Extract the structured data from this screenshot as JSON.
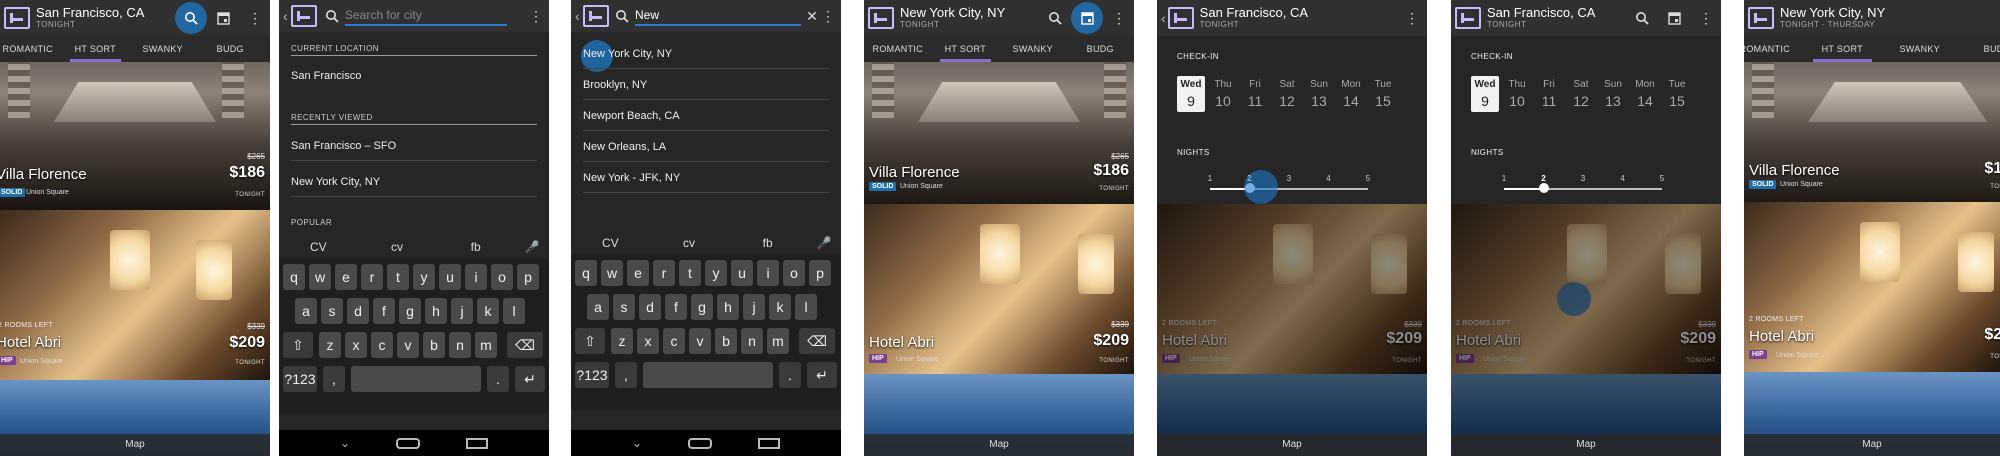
{
  "colors": {
    "accent": "#2a7bd4",
    "brand": "#c9b9ff",
    "tab_indicator": "#8c6fd6",
    "solid_badge": "#1e6fa8",
    "hip_badge": "#7b3f8f"
  },
  "tabs": [
    "ROMANTIC",
    "HT SORT",
    "SWANKY",
    "BUDG"
  ],
  "hotels": [
    {
      "name": "Villa Florence",
      "badge": "SOLID",
      "area": "Union Square",
      "old_price": "$265",
      "price": "$186",
      "per": "TONIGHT"
    },
    {
      "name": "Hotel Abri",
      "badge": "HIP",
      "area": "Union Square",
      "old_price": "$339",
      "price": "$209",
      "per": "TONIGHT",
      "rooms_left": "2 ROOMS LEFT"
    }
  ],
  "map_label": "Map",
  "screen1": {
    "city": "San Francisco, CA",
    "date": "TONIGHT"
  },
  "screen2": {
    "placeholder": "Search for city",
    "current_location_header": "CURRENT LOCATION",
    "current_location": "San Francisco",
    "recently_viewed_header": "RECENTLY VIEWED",
    "recent": [
      "San Francisco – SFO",
      "New York City, NY"
    ],
    "popular_header": "POPULAR"
  },
  "screen3": {
    "query": "New",
    "results": [
      "New York City, NY",
      "Brooklyn, NY",
      "Newport Beach, CA",
      "New Orleans, LA",
      "New York - JFK, NY"
    ]
  },
  "keyboard": {
    "suggestions": [
      "CV",
      "cv",
      "fb"
    ],
    "row1": [
      "q",
      "w",
      "e",
      "r",
      "t",
      "y",
      "u",
      "i",
      "o",
      "p"
    ],
    "row2": [
      "a",
      "s",
      "d",
      "f",
      "g",
      "h",
      "j",
      "k",
      "l"
    ],
    "row3": [
      "z",
      "x",
      "c",
      "v",
      "b",
      "n",
      "m"
    ],
    "symbols_key": "?123",
    "comma_key": ",",
    "period_key": "."
  },
  "screen4": {
    "city": "New York City, NY",
    "date": "TONIGHT"
  },
  "screen5": {
    "city": "San Francisco, CA",
    "date": "TONIGHT"
  },
  "checkin": {
    "header": "CHECK-IN",
    "days": [
      {
        "n": "Wed",
        "d": "9"
      },
      {
        "n": "Thu",
        "d": "10"
      },
      {
        "n": "Fri",
        "d": "11"
      },
      {
        "n": "Sat",
        "d": "12"
      },
      {
        "n": "Sun",
        "d": "13"
      },
      {
        "n": "Mon",
        "d": "14"
      },
      {
        "n": "Tue",
        "d": "15"
      }
    ],
    "selected_index": 0
  },
  "nights": {
    "header": "NIGHTS",
    "options": [
      "1",
      "2",
      "3",
      "4",
      "5"
    ],
    "selected": "2"
  },
  "screen6": {
    "city": "San Francisco, CA",
    "date": "TONIGHT"
  },
  "screen7": {
    "city": "New York City, NY",
    "date": "TONIGHT - THURSDAY"
  }
}
